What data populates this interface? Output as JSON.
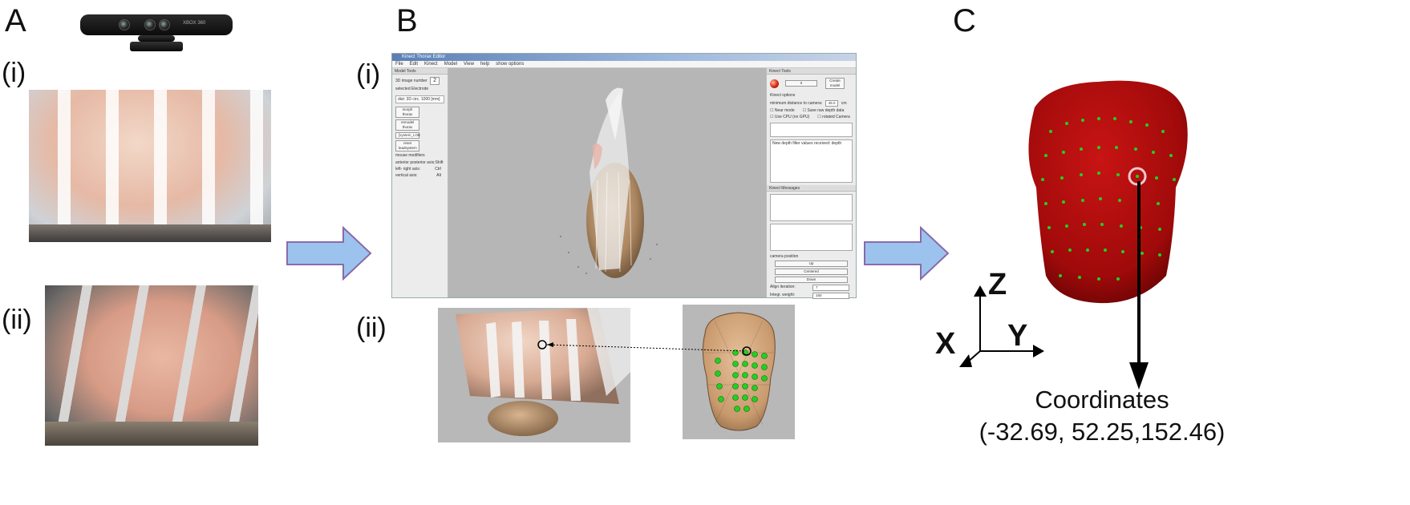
{
  "panels": {
    "a": {
      "letter": "A",
      "sub_i": "(i)",
      "sub_ii": "(ii)"
    },
    "b": {
      "letter": "B",
      "sub_i": "(i)",
      "sub_ii": "(ii)"
    },
    "c": {
      "letter": "C"
    }
  },
  "kinect": {
    "brand_text": "XBOX 360"
  },
  "software": {
    "window_title": "Kinect Thorax Editor",
    "menu": [
      "File",
      "Edit",
      "Kinect",
      "Model",
      "View",
      "help",
      "show options"
    ],
    "left_pane": {
      "title": "Model Tools",
      "image_number_label": "3D image number",
      "image_number_value": "2",
      "selected_electrode_label": "selected Electrode",
      "electrode_value": "dist: 3D circ. 1000 [mm]",
      "morph_button": "morph thorax",
      "remodel_button": "remodel thorax",
      "system_select": "[system_LOE",
      "reset_button": "reset leadsystem",
      "mouse_modifiers_label": "mouse modifiers",
      "modifiers": [
        {
          "axis": "anterior posterior axis:",
          "key": "Shift"
        },
        {
          "axis": "left- right axis:",
          "key": "Ctrl"
        },
        {
          "axis": "vertical axis:",
          "key": "Alt"
        }
      ]
    },
    "right_pane": {
      "title": "Kinect Tools",
      "count_value": "0",
      "create_model_button": "Create model",
      "options_label": "Kinect options",
      "min_distance_label": "minimum distance to camera:",
      "min_distance_value": "45.0",
      "min_distance_unit": "cm",
      "near_mode": "Near mode",
      "save_raw": "Save raw depth data",
      "use_cpu": "Use CPU (no GPU)",
      "rotated_camera": "rotated Camera",
      "depth_filter_text": "New depth filter values received: depth",
      "messages_title": "Kinect Messages",
      "camera_position_label": "camera position",
      "up_button": "Up",
      "centered_button": "Centered",
      "down_button": "Down",
      "iteration_label": "Align iteration:",
      "iteration_value": "7",
      "weight_label": "Integr. weight:",
      "weight_value": "150"
    }
  },
  "axes": {
    "z": "Z",
    "y": "Y",
    "x": "X"
  },
  "coordinates": {
    "title": "Coordinates",
    "value": "(-32.69, 52.25,152.46)"
  },
  "colors": {
    "arrow_fill": "#9cc3ee",
    "arrow_stroke": "#8a6aa8",
    "torso_red": "#b30c0c",
    "electrode_green": "#22d022",
    "model_beige": "#d2a57a"
  }
}
